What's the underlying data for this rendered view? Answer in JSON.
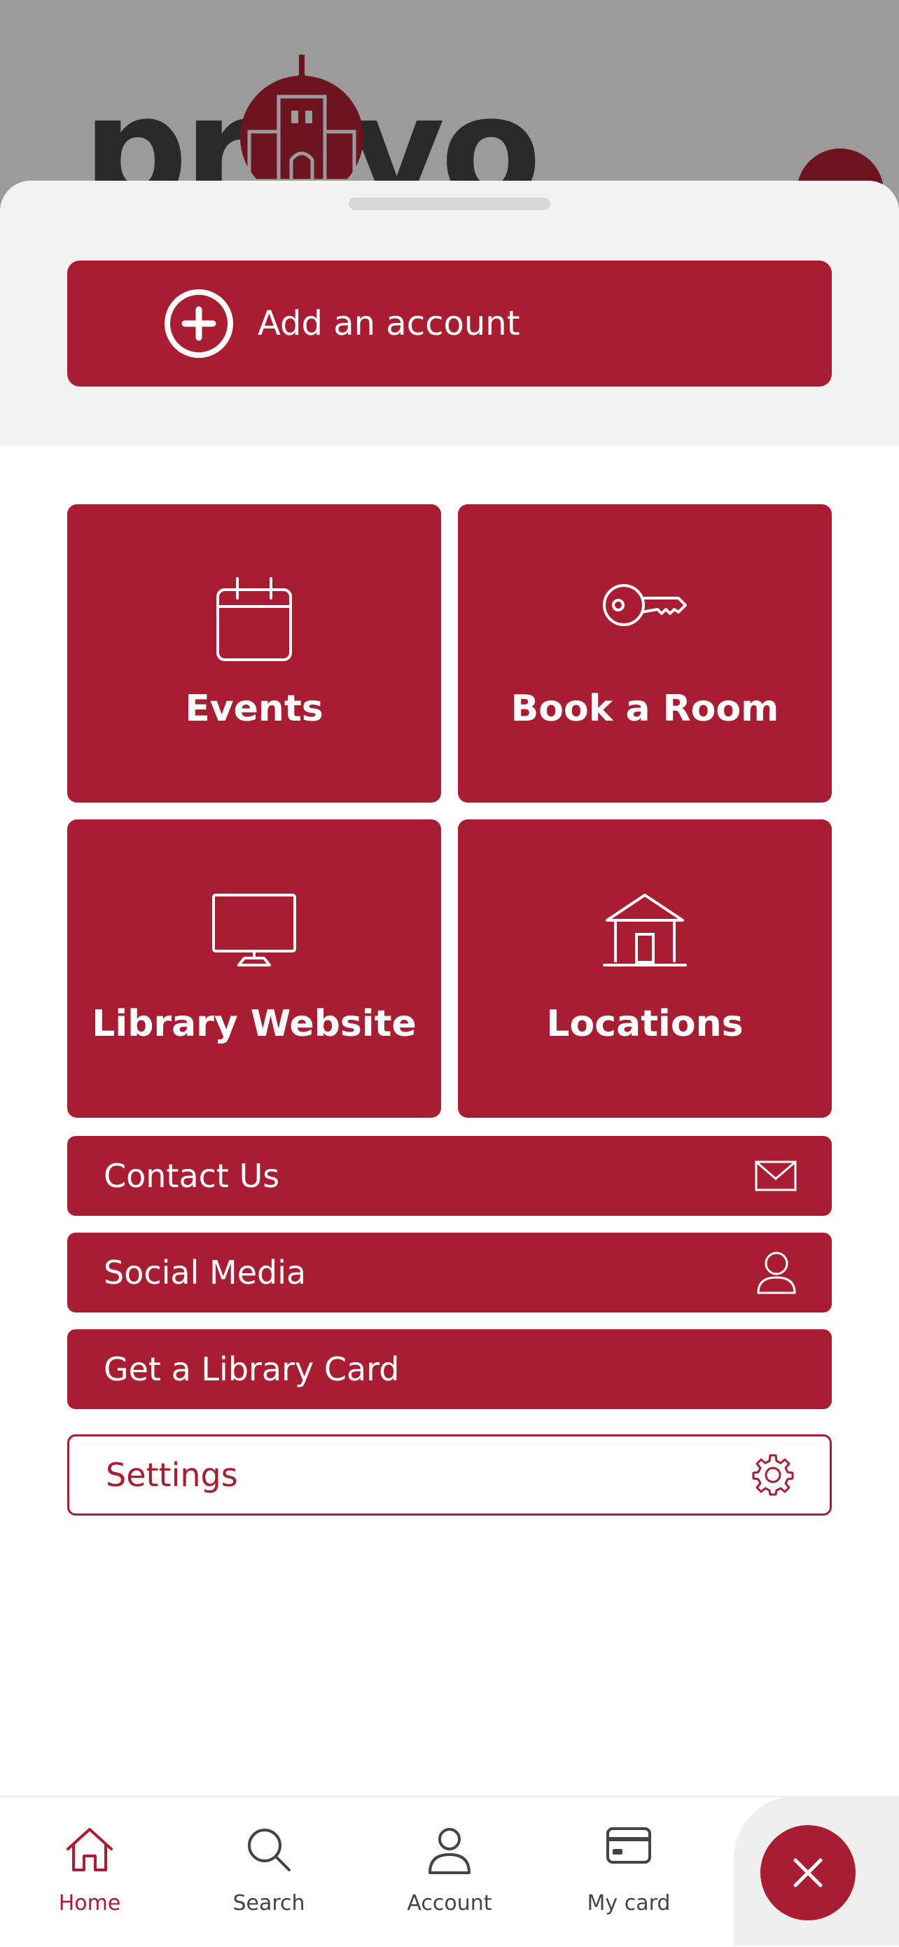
{
  "header": {
    "logo_text": "provo"
  },
  "account": {
    "add_label": "Add an account"
  },
  "tiles": [
    {
      "label": "Events",
      "icon": "calendar-icon"
    },
    {
      "label": "Book a Room",
      "icon": "key-icon"
    },
    {
      "label": "Library Website",
      "icon": "monitor-icon"
    },
    {
      "label": "Locations",
      "icon": "building-icon"
    }
  ],
  "rows": [
    {
      "label": "Contact Us",
      "icon": "envelope-icon"
    },
    {
      "label": "Social Media",
      "icon": "person-icon"
    },
    {
      "label": "Get a Library Card",
      "icon": ""
    },
    {
      "label": "Settings",
      "icon": "gear-icon"
    }
  ],
  "nav": [
    {
      "label": "Home",
      "icon": "home-icon",
      "active": true
    },
    {
      "label": "Search",
      "icon": "search-icon",
      "active": false
    },
    {
      "label": "Account",
      "icon": "account-icon",
      "active": false
    },
    {
      "label": "My card",
      "icon": "card-icon",
      "active": false
    }
  ],
  "colors": {
    "brand": "#a81d31",
    "sheet_top": "#f2f2f2",
    "backdrop": "#9b9b9b"
  }
}
